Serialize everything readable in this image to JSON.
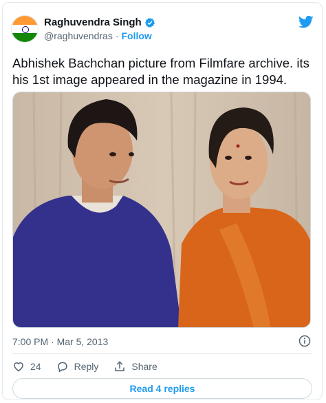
{
  "author": {
    "name": "Raghuvendra Singh",
    "handle": "@raghuvendras",
    "separator": "·",
    "follow_label": "Follow",
    "verified": true,
    "avatar_icon": "indian-flag-avatar"
  },
  "tweet": {
    "text": "Abhishek Bachchan picture from Filmfare archive. its his 1st image appeared in the magazine in 1994.",
    "timestamp": "7:00 PM · Mar 5, 2013"
  },
  "actions": {
    "like_count": "24",
    "reply_label": "Reply",
    "share_label": "Share"
  },
  "replies_button_label": "Read 4 replies",
  "colors": {
    "accent": "#1d9bf0",
    "text": "#0f1419",
    "muted": "#536471",
    "border": "#cfd9de"
  }
}
